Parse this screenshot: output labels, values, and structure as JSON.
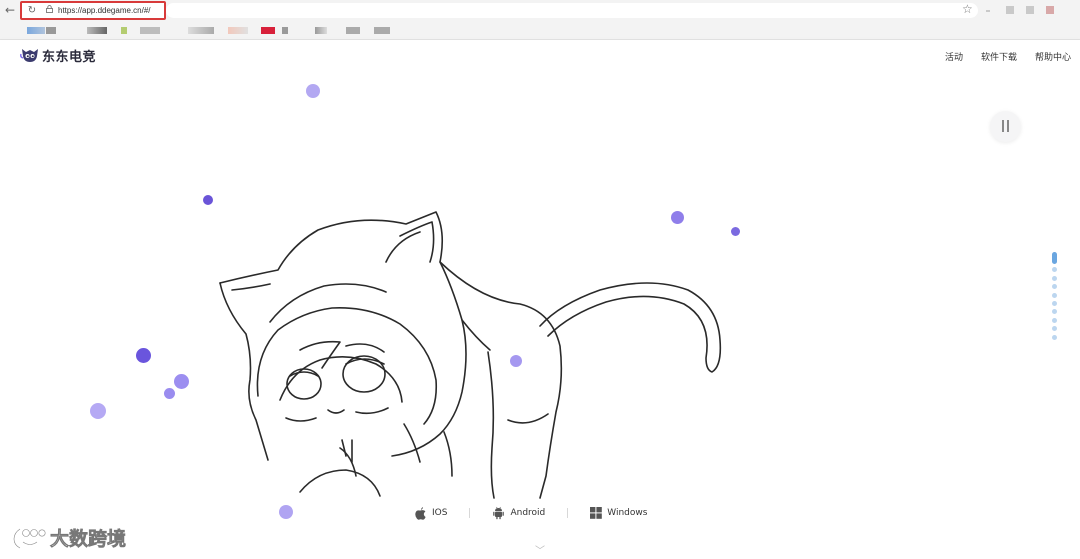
{
  "browser": {
    "url": "https://app.ddegame.cn/#/",
    "back_icon": "arrow-left-icon",
    "reload_icon": "reload-icon",
    "star_icon": "star-icon"
  },
  "site": {
    "logo_text": "东东电竞",
    "nav": [
      {
        "label": "活动"
      },
      {
        "label": "软件下载"
      },
      {
        "label": "帮助中心"
      }
    ]
  },
  "downloads": [
    {
      "label": "IOS",
      "icon": "apple-icon"
    },
    {
      "label": "Android",
      "icon": "android-icon"
    },
    {
      "label": "Windows",
      "icon": "windows-icon"
    }
  ],
  "watermark": {
    "text": "大数跨境"
  },
  "colors": {
    "accent": "#7b6ae8",
    "pager_active": "#6aa6e0",
    "address_highlight": "#d83a3a"
  }
}
